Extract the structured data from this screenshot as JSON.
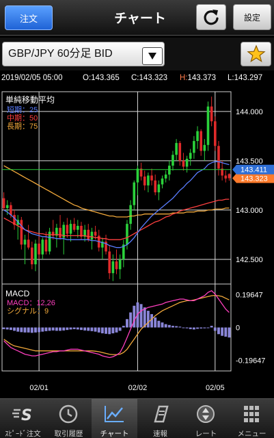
{
  "header": {
    "order_button": "注文",
    "title": "チャート",
    "settings_button": "設定",
    "refresh_icon": "refresh-icon"
  },
  "selector": {
    "pair_value": "GBP/JPY 60分足 BID",
    "favorite_icon": "star-icon"
  },
  "ohlc": {
    "datetime": "2019/02/05 05:00",
    "open": "O:143.365",
    "close": "C:143.323",
    "high_label": "H:",
    "high_value": "143.373",
    "low": "L:143.297"
  },
  "chart_data": [
    {
      "type": "candlestick",
      "title": "単純移動平均",
      "legend": [
        {
          "label": "短期：25",
          "color": "#5a7dff"
        },
        {
          "label": "中期：50",
          "color": "#ff4040"
        },
        {
          "label": "長期：75",
          "color": "#f2a93b"
        }
      ],
      "y_ticks": [
        "144.000",
        "143.500",
        "143.000",
        "142.500"
      ],
      "ylim": [
        142.25,
        144.2
      ],
      "current_price": "143.411",
      "last_price": "143.323",
      "up_color": "#2bd13b",
      "down_color": "#e02a2a",
      "candles": [
        [
          143.12,
          143.18,
          143.0,
          143.02
        ],
        [
          143.02,
          143.1,
          142.95,
          143.05
        ],
        [
          143.05,
          143.08,
          142.92,
          142.95
        ],
        [
          142.95,
          143.0,
          142.8,
          142.85
        ],
        [
          142.85,
          142.95,
          142.7,
          142.9
        ],
        [
          142.9,
          142.93,
          142.6,
          142.65
        ],
        [
          142.65,
          142.75,
          142.45,
          142.7
        ],
        [
          142.7,
          142.85,
          142.6,
          142.62
        ],
        [
          142.62,
          142.68,
          142.4,
          142.45
        ],
        [
          142.45,
          142.7,
          142.38,
          142.66
        ],
        [
          142.66,
          142.75,
          142.5,
          142.55
        ],
        [
          142.55,
          142.72,
          142.5,
          142.7
        ],
        [
          142.7,
          142.78,
          142.55,
          142.58
        ],
        [
          142.58,
          142.82,
          142.55,
          142.78
        ],
        [
          142.78,
          142.9,
          142.7,
          142.74
        ],
        [
          142.74,
          142.86,
          142.62,
          142.82
        ],
        [
          142.82,
          142.95,
          142.7,
          142.72
        ],
        [
          142.72,
          142.88,
          142.55,
          142.85
        ],
        [
          142.85,
          142.92,
          142.72,
          142.76
        ],
        [
          142.76,
          142.9,
          142.68,
          142.86
        ],
        [
          142.86,
          142.92,
          142.78,
          142.8
        ],
        [
          142.8,
          142.9,
          142.72,
          142.84
        ],
        [
          142.84,
          142.88,
          142.7,
          142.73
        ],
        [
          142.73,
          142.85,
          142.68,
          142.8
        ],
        [
          142.8,
          142.86,
          142.68,
          142.7
        ],
        [
          142.7,
          142.82,
          142.6,
          142.78
        ],
        [
          142.78,
          142.84,
          142.7,
          142.74
        ],
        [
          142.74,
          142.8,
          142.58,
          142.62
        ],
        [
          142.62,
          142.72,
          142.5,
          142.68
        ],
        [
          142.68,
          142.75,
          142.55,
          142.58
        ],
        [
          142.58,
          142.64,
          142.3,
          142.36
        ],
        [
          142.36,
          142.55,
          142.28,
          142.48
        ],
        [
          142.48,
          142.6,
          142.35,
          142.4
        ],
        [
          142.4,
          142.55,
          142.3,
          142.5
        ],
        [
          142.5,
          142.7,
          142.42,
          142.65
        ],
        [
          142.65,
          142.9,
          142.6,
          142.86
        ],
        [
          142.86,
          143.1,
          142.8,
          143.05
        ],
        [
          143.05,
          143.3,
          143.0,
          143.28
        ],
        [
          143.28,
          143.45,
          143.15,
          143.42
        ],
        [
          143.42,
          143.48,
          143.3,
          143.34
        ],
        [
          143.34,
          143.4,
          143.2,
          143.25
        ],
        [
          143.25,
          143.38,
          143.18,
          143.35
        ],
        [
          143.35,
          143.42,
          143.25,
          143.3
        ],
        [
          143.3,
          143.36,
          143.15,
          143.18
        ],
        [
          143.18,
          143.3,
          143.1,
          143.26
        ],
        [
          143.26,
          143.35,
          143.22,
          143.32
        ],
        [
          143.32,
          143.4,
          143.28,
          143.36
        ],
        [
          143.36,
          143.5,
          143.3,
          143.45
        ],
        [
          143.45,
          143.6,
          143.4,
          143.56
        ],
        [
          143.56,
          143.72,
          143.5,
          143.68
        ],
        [
          143.68,
          143.7,
          143.45,
          143.5
        ],
        [
          143.5,
          143.58,
          143.4,
          143.44
        ],
        [
          143.44,
          143.55,
          143.38,
          143.52
        ],
        [
          143.52,
          143.62,
          143.45,
          143.58
        ],
        [
          143.58,
          143.75,
          143.52,
          143.7
        ],
        [
          143.7,
          143.85,
          143.62,
          143.8
        ],
        [
          143.8,
          143.82,
          143.55,
          143.6
        ],
        [
          143.6,
          143.72,
          143.5,
          143.66
        ],
        [
          143.66,
          144.1,
          143.6,
          144.05
        ],
        [
          144.05,
          144.15,
          143.85,
          143.9
        ],
        [
          143.9,
          143.95,
          143.6,
          143.65
        ],
        [
          143.65,
          143.7,
          143.35,
          143.42
        ],
        [
          143.42,
          143.5,
          143.3,
          143.35
        ],
        [
          143.35,
          143.4,
          143.28,
          143.32
        ],
        [
          143.365,
          143.373,
          143.297,
          143.323
        ]
      ],
      "ma_short": [
        143.0,
        142.98,
        142.95,
        142.92,
        142.88,
        142.84,
        142.8,
        142.78,
        142.76,
        142.75,
        142.74,
        142.73,
        142.73,
        142.72,
        142.72,
        142.71,
        142.71,
        142.71,
        142.7,
        142.7,
        142.7,
        142.7,
        142.7,
        142.7,
        142.7,
        142.69,
        142.69,
        142.68,
        142.67,
        142.66,
        142.64,
        142.63,
        142.62,
        142.62,
        142.63,
        142.65,
        142.68,
        142.72,
        142.77,
        142.82,
        142.86,
        142.9,
        142.94,
        142.97,
        143.0,
        143.03,
        143.06,
        143.09,
        143.12,
        143.16,
        143.2,
        143.23,
        143.27,
        143.3,
        143.34,
        143.38,
        143.4,
        143.42,
        143.46,
        143.48,
        143.49,
        143.49,
        143.48,
        143.47,
        143.46
      ],
      "ma_mid": [
        142.92,
        142.9,
        142.88,
        142.86,
        142.84,
        142.82,
        142.8,
        142.79,
        142.78,
        142.77,
        142.76,
        142.76,
        142.75,
        142.75,
        142.75,
        142.75,
        142.75,
        142.74,
        142.74,
        142.74,
        142.74,
        142.74,
        142.74,
        142.74,
        142.73,
        142.73,
        142.72,
        142.72,
        142.71,
        142.71,
        142.7,
        142.7,
        142.7,
        142.7,
        142.71,
        142.72,
        142.74,
        142.76,
        142.78,
        142.8,
        142.82,
        142.84,
        142.86,
        142.88,
        142.89,
        142.91,
        142.93,
        142.94,
        142.96,
        142.97,
        142.99,
        143.0,
        143.01,
        143.02,
        143.03,
        143.04,
        143.05,
        143.06,
        143.07,
        143.08,
        143.09,
        143.1,
        143.1,
        143.11,
        143.11
      ],
      "ma_long": [
        143.45,
        143.43,
        143.41,
        143.39,
        143.37,
        143.35,
        143.33,
        143.31,
        143.29,
        143.27,
        143.25,
        143.23,
        143.21,
        143.19,
        143.17,
        143.15,
        143.13,
        143.11,
        143.09,
        143.07,
        143.05,
        143.04,
        143.02,
        143.01,
        143.0,
        142.99,
        142.98,
        142.97,
        142.96,
        142.95,
        142.94,
        142.94,
        142.93,
        142.93,
        142.93,
        142.93,
        142.94,
        142.94,
        142.95,
        142.95,
        142.96,
        142.96,
        142.96,
        142.96,
        142.96,
        142.96,
        142.96,
        142.96,
        142.97,
        142.97,
        142.97,
        142.97,
        142.98,
        142.98,
        142.98,
        142.99,
        142.99,
        142.99,
        143.0,
        143.0,
        143.01,
        143.01,
        143.01,
        143.02,
        143.02
      ]
    },
    {
      "type": "macd",
      "title": "MACD",
      "legend": [
        {
          "label": "MACD：12,26",
          "color": "#ff3fbf"
        },
        {
          "label": "シグナル：9",
          "color": "#f2a93b"
        }
      ],
      "y_ticks": [
        "0.19647",
        "0",
        "-0.19647"
      ],
      "ylim": [
        -0.26,
        0.26
      ],
      "x_ticks": [
        "02/01",
        "02/02",
        "02/05"
      ],
      "histogram": [
        -0.01,
        -0.012,
        -0.015,
        -0.02,
        -0.025,
        -0.028,
        -0.03,
        -0.03,
        -0.032,
        -0.03,
        -0.028,
        -0.025,
        -0.022,
        -0.02,
        -0.018,
        -0.02,
        -0.02,
        -0.018,
        -0.015,
        -0.012,
        -0.01,
        -0.012,
        -0.015,
        -0.018,
        -0.02,
        -0.022,
        -0.025,
        -0.03,
        -0.035,
        -0.038,
        -0.04,
        -0.035,
        -0.03,
        -0.02,
        0.01,
        0.05,
        0.09,
        0.13,
        0.15,
        0.14,
        0.12,
        0.1,
        0.08,
        0.06,
        0.04,
        0.03,
        0.02,
        0.015,
        0.01,
        0.008,
        0.005,
        0.0,
        -0.005,
        -0.01,
        -0.012,
        -0.008,
        -0.006,
        -0.005,
        0.0,
        0.01,
        -0.02,
        -0.04,
        -0.05,
        -0.055,
        -0.06
      ],
      "macd": [
        -0.08,
        -0.1,
        -0.12,
        -0.13,
        -0.14,
        -0.15,
        -0.16,
        -0.165,
        -0.17,
        -0.17,
        -0.165,
        -0.16,
        -0.155,
        -0.15,
        -0.145,
        -0.145,
        -0.14,
        -0.14,
        -0.135,
        -0.13,
        -0.13,
        -0.13,
        -0.135,
        -0.14,
        -0.145,
        -0.15,
        -0.155,
        -0.16,
        -0.17,
        -0.175,
        -0.18,
        -0.175,
        -0.165,
        -0.15,
        -0.11,
        -0.06,
        -0.01,
        0.04,
        0.08,
        0.1,
        0.11,
        0.12,
        0.125,
        0.13,
        0.135,
        0.14,
        0.15,
        0.155,
        0.16,
        0.165,
        0.17,
        0.17,
        0.165,
        0.16,
        0.16,
        0.17,
        0.18,
        0.19,
        0.21,
        0.22,
        0.2,
        0.17,
        0.14,
        0.11,
        0.09
      ],
      "signal": [
        -0.07,
        -0.085,
        -0.1,
        -0.11,
        -0.115,
        -0.12,
        -0.125,
        -0.13,
        -0.135,
        -0.14,
        -0.14,
        -0.14,
        -0.14,
        -0.14,
        -0.14,
        -0.14,
        -0.14,
        -0.14,
        -0.14,
        -0.14,
        -0.14,
        -0.14,
        -0.14,
        -0.14,
        -0.14,
        -0.14,
        -0.142,
        -0.145,
        -0.15,
        -0.155,
        -0.16,
        -0.162,
        -0.162,
        -0.16,
        -0.15,
        -0.13,
        -0.1,
        -0.07,
        -0.04,
        -0.01,
        0.01,
        0.03,
        0.05,
        0.07,
        0.085,
        0.1,
        0.11,
        0.12,
        0.13,
        0.14,
        0.15,
        0.155,
        0.16,
        0.16,
        0.165,
        0.17,
        0.175,
        0.18,
        0.185,
        0.19,
        0.192,
        0.19,
        0.185,
        0.175,
        0.165
      ]
    }
  ],
  "tabs": [
    {
      "label": "ｽﾋﾟｰﾄﾞ注文",
      "icon": "speed-order-icon"
    },
    {
      "label": "取引履歴",
      "icon": "history-icon"
    },
    {
      "label": "チャート",
      "icon": "chart-icon"
    },
    {
      "label": "速報",
      "icon": "news-icon"
    },
    {
      "label": "レート",
      "icon": "rate-icon"
    },
    {
      "label": "メニュー",
      "icon": "menu-icon"
    }
  ]
}
